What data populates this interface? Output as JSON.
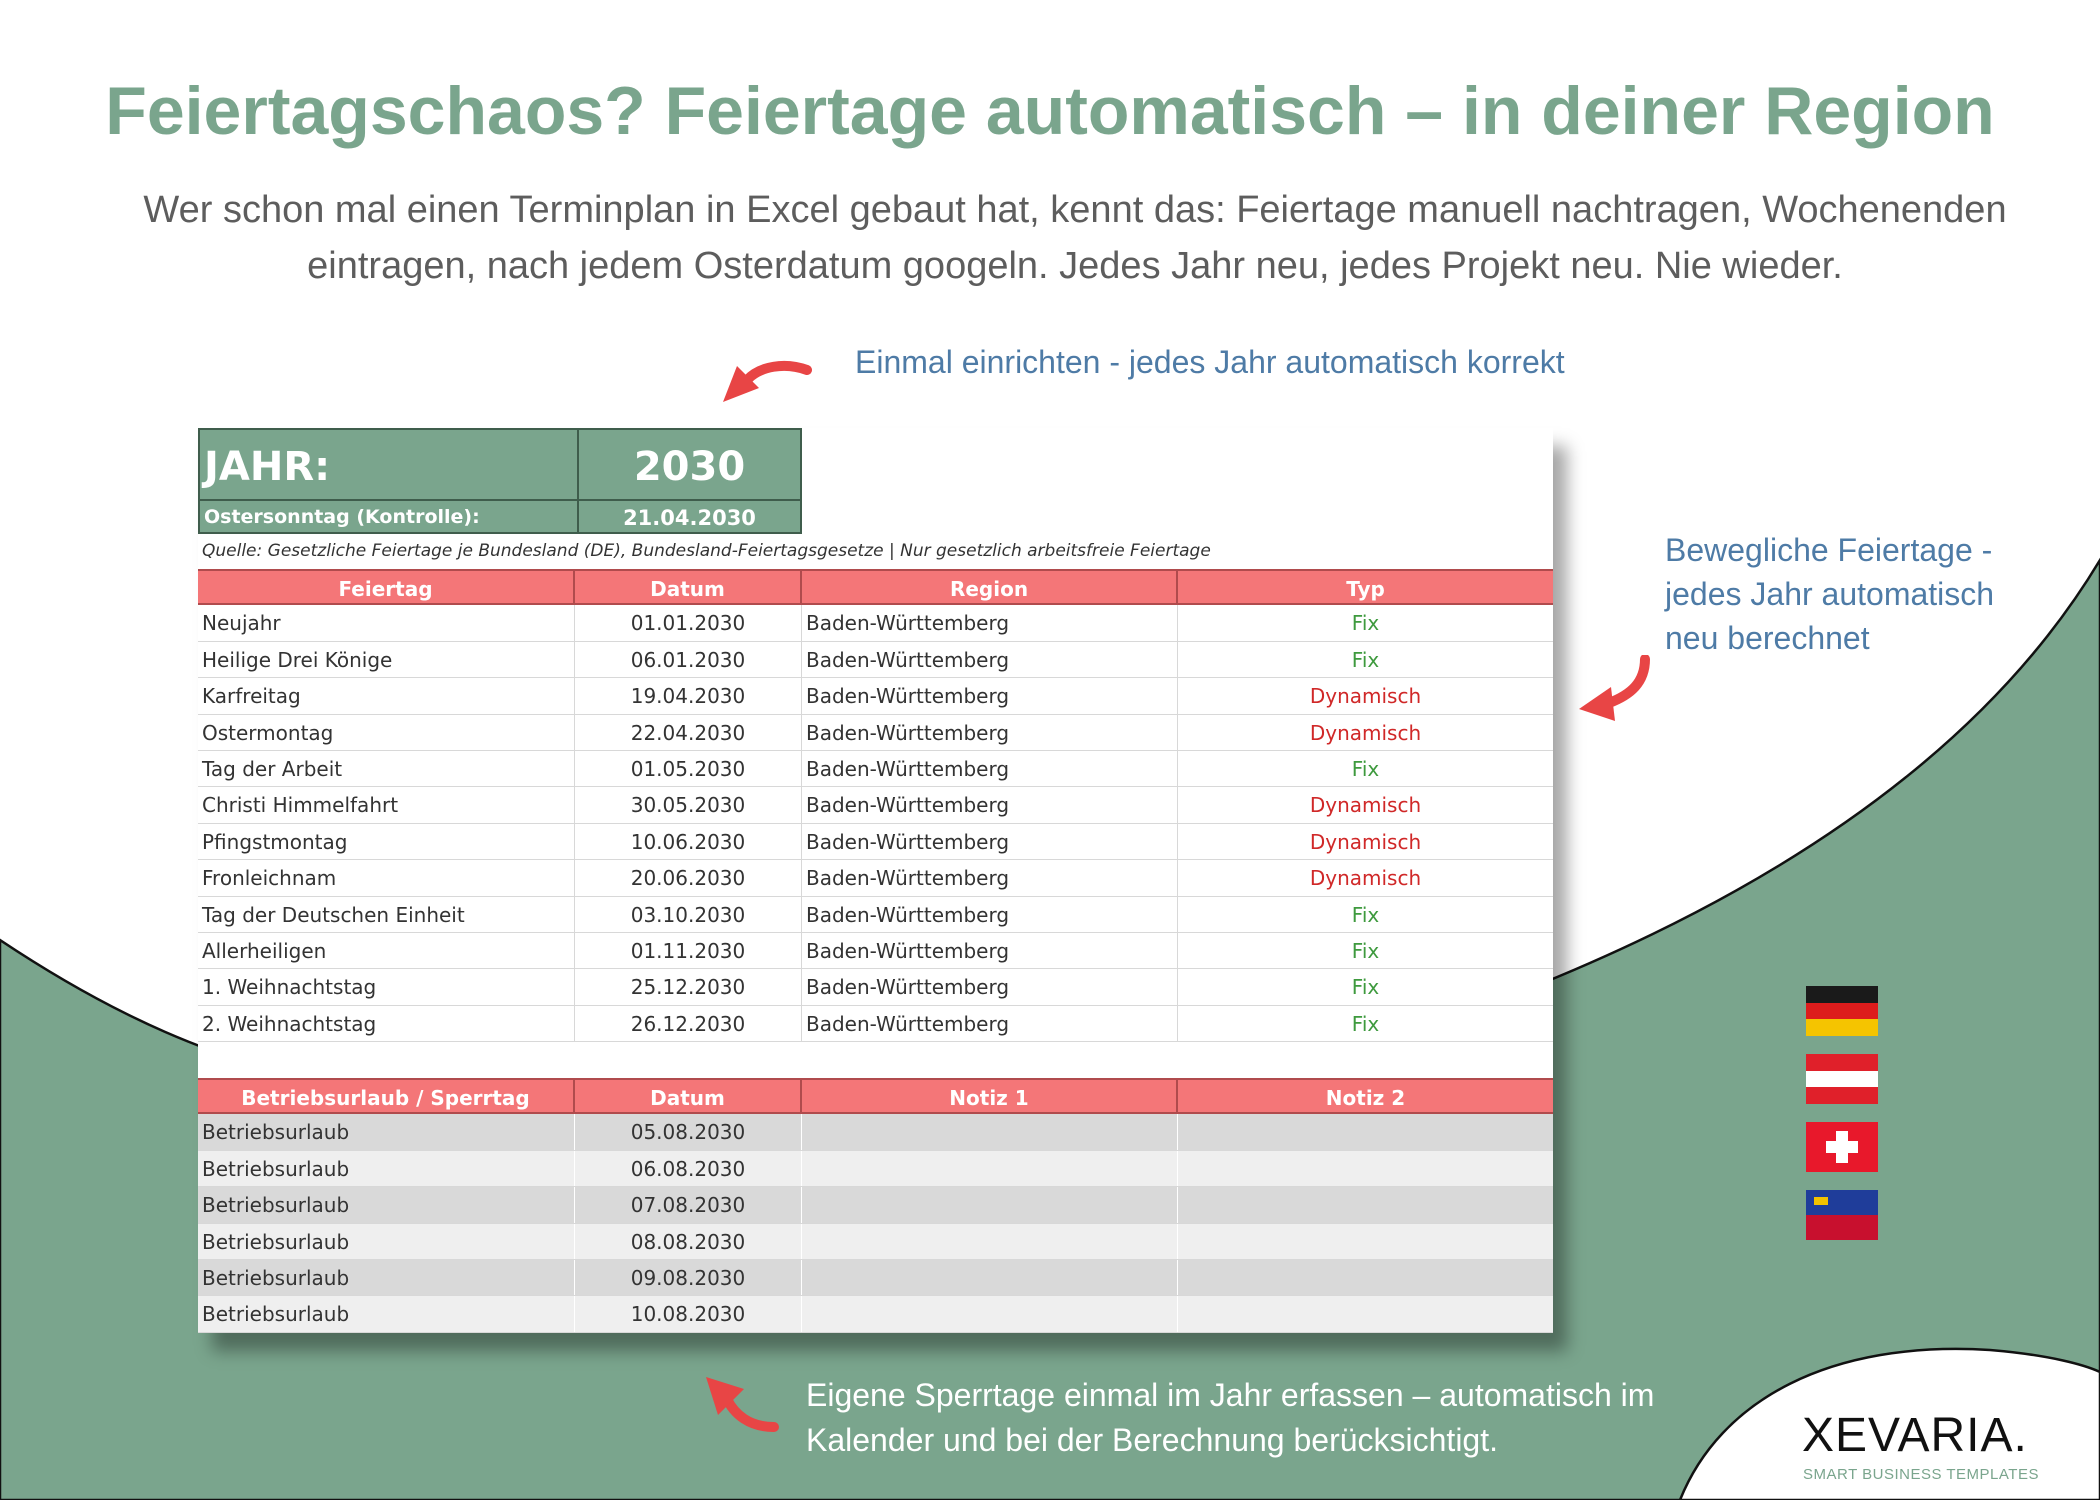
{
  "headline": "Feiertagschaos? Feiertage automatisch – in deiner Region",
  "subline_1": "Wer schon mal einen Terminplan in Excel gebaut hat, kennt das: Feiertage manuell nachtragen, Wochenenden",
  "subline_2": "eintragen, nach jedem Osterdatum googeln. Jedes Jahr neu, jedes Projekt neu. Nie wieder.",
  "callouts": {
    "top": "Einmal einrichten - jedes Jahr automatisch korrekt",
    "right_1": "Bewegliche Feiertage  -",
    "right_2": "jedes Jahr automatisch",
    "right_3": "neu berechnet",
    "bottom_1": "Eigene Sperrtage einmal im Jahr erfassen – automatisch im",
    "bottom_2": "Kalender und bei der Berechnung berücksichtigt."
  },
  "sheet": {
    "year_label": "JAHR:",
    "year_value": "2030",
    "easter_label": "Ostersonntag (Kontrolle):",
    "easter_value": "21.04.2030",
    "source": "Quelle: Gesetzliche Feiertage je Bundesland (DE), Bundesland-Feiertagsgesetze | Nur gesetzlich arbeitsfreie Feiertage",
    "holidays_header": [
      "Feiertag",
      "Datum",
      "Region",
      "Typ"
    ],
    "holidays": [
      [
        "Neujahr",
        "01.01.2030",
        "Baden-Württemberg",
        "Fix"
      ],
      [
        "Heilige Drei Könige",
        "06.01.2030",
        "Baden-Württemberg",
        "Fix"
      ],
      [
        "Karfreitag",
        "19.04.2030",
        "Baden-Württemberg",
        "Dynamisch"
      ],
      [
        "Ostermontag",
        "22.04.2030",
        "Baden-Württemberg",
        "Dynamisch"
      ],
      [
        "Tag der Arbeit",
        "01.05.2030",
        "Baden-Württemberg",
        "Fix"
      ],
      [
        "Christi Himmelfahrt",
        "30.05.2030",
        "Baden-Württemberg",
        "Dynamisch"
      ],
      [
        "Pfingstmontag",
        "10.06.2030",
        "Baden-Württemberg",
        "Dynamisch"
      ],
      [
        "Fronleichnam",
        "20.06.2030",
        "Baden-Württemberg",
        "Dynamisch"
      ],
      [
        "Tag der Deutschen Einheit",
        "03.10.2030",
        "Baden-Württemberg",
        "Fix"
      ],
      [
        "Allerheiligen",
        "01.11.2030",
        "Baden-Württemberg",
        "Fix"
      ],
      [
        "1. Weihnachtstag",
        "25.12.2030",
        "Baden-Württemberg",
        "Fix"
      ],
      [
        "2. Weihnachtstag",
        "26.12.2030",
        "Baden-Württemberg",
        "Fix"
      ]
    ],
    "closures_header": [
      "Betriebsurlaub / Sperrtag",
      "Datum",
      "Notiz 1",
      "Notiz 2"
    ],
    "closures": [
      [
        "Betriebsurlaub",
        "05.08.2030",
        "",
        ""
      ],
      [
        "Betriebsurlaub",
        "06.08.2030",
        "",
        ""
      ],
      [
        "Betriebsurlaub",
        "07.08.2030",
        "",
        ""
      ],
      [
        "Betriebsurlaub",
        "08.08.2030",
        "",
        ""
      ],
      [
        "Betriebsurlaub",
        "09.08.2030",
        "",
        ""
      ],
      [
        "Betriebsurlaub",
        "10.08.2030",
        "",
        ""
      ]
    ]
  },
  "brand": {
    "name": "XEVARIA.",
    "tagline": "SMART BUSINESS TEMPLATES"
  },
  "colors": {
    "accent_green": "#7aa58d",
    "header_red": "#f47678",
    "callout_blue": "#4e7ba6",
    "fix_green": "#3e9a3e",
    "dynamic_red": "#d02828",
    "arrow_red": "#e84545"
  },
  "flags": [
    "germany-flag",
    "austria-flag",
    "switzerland-flag",
    "liechtenstein-flag"
  ]
}
